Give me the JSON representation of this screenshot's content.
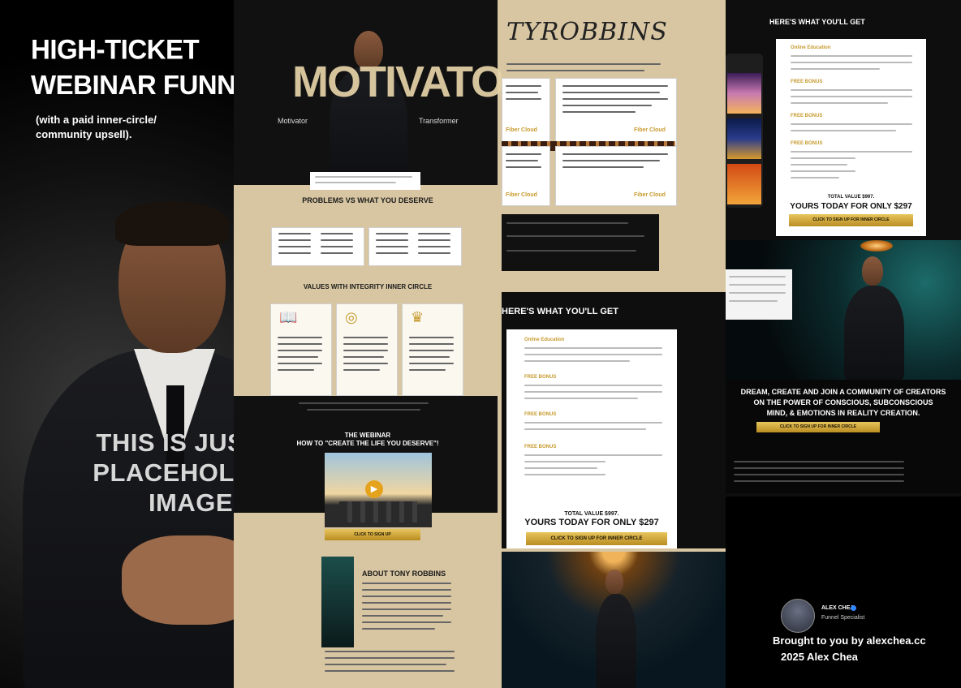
{
  "hero": {
    "title_line1": "HIGH-TICKET",
    "title_line2": "WEBINAR FUNNEL",
    "subtitle_line1": "(with a paid inner-circle/",
    "subtitle_line2": "community upsell).",
    "placeholder_line1": "THIS IS JUST A",
    "placeholder_line2": "PLACEHOLDER",
    "placeholder_line3": "IMAGE"
  },
  "page2": {
    "brand": "MOTIVATOR",
    "tag_left": "Motivator",
    "tag_right": "Transformer",
    "problems_heading": "PROBLEMS VS WHAT YOU DESERVE",
    "values_heading": "VALUES WITH INTEGRITY INNER CIRCLE",
    "webinar_heading_line1": "THE WEBINAR",
    "webinar_heading_line2": "HOW TO \"CREATE THE LIFE YOU DESERVE\"!",
    "about_heading": "ABOUT TONY ROBBINS"
  },
  "page3": {
    "signature": "TYROBBINS",
    "label_left_1": "Fiber Cloud",
    "label_right_1": "Fiber Cloud",
    "label_left_2": "Fiber Cloud",
    "label_right_2": "Fiber Cloud",
    "offer_heading": "HERE'S WHAT YOU'LL GET",
    "bonus_labels": [
      "Online Education",
      "FREE BONUS",
      "FREE BONUS",
      "FREE BONUS"
    ],
    "value_line": "TOTAL VALUE $997.",
    "price_line": "YOURS TODAY FOR ONLY $297",
    "cta": "CLICK TO SIGN UP FOR INNER CIRCLE"
  },
  "page4": {
    "offer_heading": "HERE'S WHAT YOU'LL GET",
    "bonus_labels": [
      "Online Education",
      "FREE BONUS",
      "FREE BONUS",
      "FREE BONUS"
    ],
    "value_line": "TOTAL VALUE $997.",
    "price_line": "YOURS TODAY FOR ONLY $297",
    "cta": "CLICK TO SIGN UP FOR INNER CIRCLE",
    "community_line1": "DREAM, CREATE AND JOIN A COMMUNITY OF CREATORS",
    "community_line2": "ON THE POWER OF CONSCIOUS, SUBCONSCIOUS",
    "community_line3": "MIND, & EMOTIONS IN REALITY CREATION.",
    "community_cta": "CLICK TO SIGN UP FOR INNER CIRCLE"
  },
  "credit": {
    "name": "ALEX CHEA",
    "role": "Funnel Specialist",
    "brought_by": "Brought to you by alexchea.cc",
    "copyright": "2025 Alex Chea",
    "verified_color": "#2f86ff"
  },
  "icons": {
    "play": "play-icon",
    "book": "book-icon",
    "target": "target-icon",
    "community": "community-icon",
    "check": "check-icon"
  },
  "colors": {
    "gold": "#c79a2e",
    "tan": "#d8c6a2",
    "dark": "#111111"
  }
}
